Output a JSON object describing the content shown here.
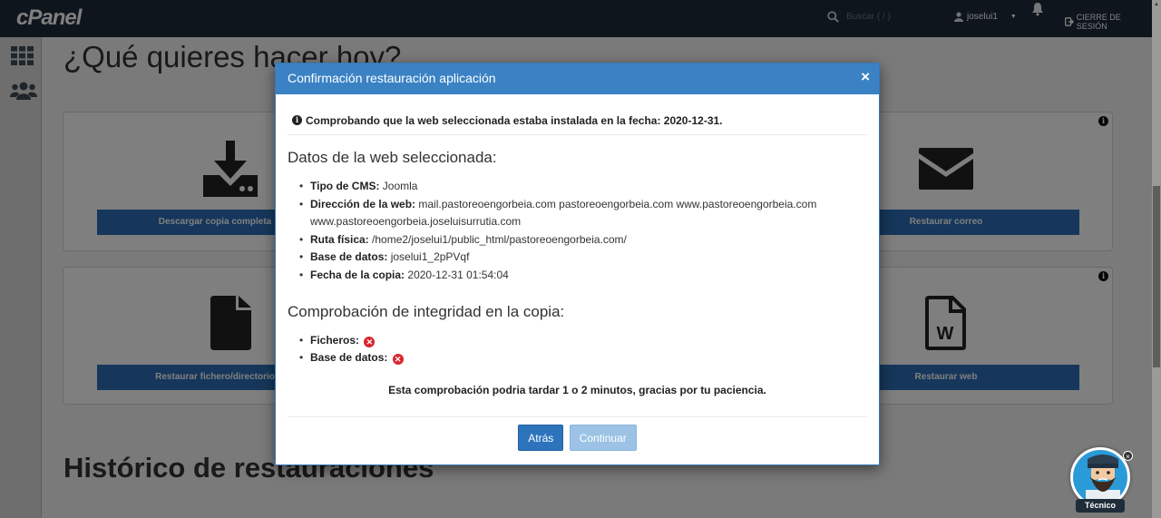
{
  "topbar": {
    "logo": "cPanel",
    "search_placeholder": "Buscar ( / )",
    "username": "joselui1",
    "logout_label": "CIERRE DE SESIÓN"
  },
  "page": {
    "title": "¿Qué quieres hacer hoy?",
    "cards": [
      {
        "label": "Descargar copia completa",
        "icon": "download-icon"
      },
      {
        "label": "Restaurar correo",
        "icon": "envelope-icon"
      },
      {
        "label": "Restaurar fichero/directorio",
        "icon": "file-icon"
      },
      {
        "label": "Restaurar web",
        "icon": "word-document-icon"
      }
    ],
    "history_title": "Histórico de restauraciones"
  },
  "modal": {
    "title": "Confirmación restauración aplicación",
    "close_symbol": "×",
    "notice": "Comprobando que la web seleccionada estaba instalada en la fecha: 2020-12-31.",
    "data_section_title": "Datos de la web seleccionada:",
    "details": [
      {
        "label": "Tipo de CMS:",
        "value": "Joomla"
      },
      {
        "label": "Dirección de la web:",
        "value": "mail.pastoreoengorbeia.com pastoreoengorbeia.com www.pastoreoengorbeia.com www.pastoreoengorbeia.joseluisurrutia.com"
      },
      {
        "label": "Ruta física:",
        "value": "/home2/joselui1/public_html/pastoreoengorbeia.com/"
      },
      {
        "label": "Base de datos:",
        "value": "joselui1_2pPVqf"
      },
      {
        "label": "Fecha de la copia:",
        "value": "2020-12-31 01:54:04"
      }
    ],
    "integrity_section_title": "Comprobación de integridad en la copia:",
    "integrity": [
      {
        "label": "Ficheros:",
        "status": "error"
      },
      {
        "label": "Base de datos:",
        "status": "error"
      }
    ],
    "wait_message": "Esta comprobación podria tardar 1 o 2 minutos, gracias por tu paciencia.",
    "back_label": "Atrás",
    "continue_label": "Continuar"
  },
  "widget": {
    "label": "Técnico"
  },
  "colors": {
    "navbar": "#1c2b3a",
    "modal_header": "#3a82c4",
    "primary_button": "#2d74bd",
    "disabled_button": "#9cc3e5",
    "error": "#d9262c"
  }
}
